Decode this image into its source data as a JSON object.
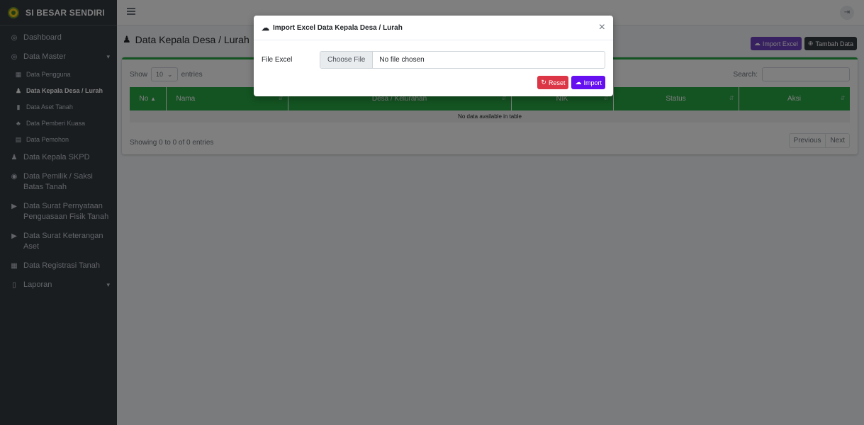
{
  "app": {
    "brand": "SI BESAR SENDIRI"
  },
  "sidebar": {
    "items": [
      {
        "label": "Dashboard",
        "icon": "dashboard-icon"
      },
      {
        "label": "Data Master",
        "icon": "database-icon"
      },
      {
        "label": "Data Pengguna",
        "icon": "users-icon"
      },
      {
        "label": "Data Kepala Desa / Lurah",
        "icon": "user-icon"
      },
      {
        "label": "Data Aset Tanah",
        "icon": "file-icon"
      },
      {
        "label": "Data Pemberi Kuasa",
        "icon": "people-icon"
      },
      {
        "label": "Data Pemohon",
        "icon": "card-icon"
      },
      {
        "label": "Data Kepala SKPD",
        "icon": "user-icon"
      },
      {
        "label": "Data Pemilik / Saksi Batas Tanah",
        "icon": "group-icon"
      },
      {
        "label": "Data Surat Pernyataan Penguasaan Fisik Tanah",
        "icon": "document-icon"
      },
      {
        "label": "Data Surat Keterangan Aset",
        "icon": "document-icon"
      },
      {
        "label": "Data Registrasi Tanah",
        "icon": "registry-icon"
      },
      {
        "label": "Laporan",
        "icon": "report-icon"
      }
    ]
  },
  "page": {
    "title": "Data Kepala Desa / Lurah",
    "import_excel_label": "Import Excel",
    "add_data_label": "Tambah Data"
  },
  "table": {
    "show_label": "Show",
    "entries_label": "entries",
    "length_value": "10",
    "search_label": "Search:",
    "columns": [
      "No",
      "Nama",
      "Desa / Kelurahan",
      "NIK",
      "Status",
      "Aksi"
    ],
    "empty_text": "No data available in table",
    "info_text": "Showing 0 to 0 of 0 entries",
    "prev_label": "Previous",
    "next_label": "Next"
  },
  "modal": {
    "title": "Import Excel Data Kepala Desa / Lurah",
    "close_glyph": "×",
    "field_label": "File Excel",
    "choose_file_label": "Choose File",
    "no_file_text": "No file chosen",
    "reset_label": "Reset",
    "import_label": "Import"
  },
  "colors": {
    "sidebar": "#343a40",
    "header_green": "#28a745",
    "purple": "#6f42c1",
    "reset_red": "#dc3545",
    "import_indigo": "#6610f2"
  }
}
